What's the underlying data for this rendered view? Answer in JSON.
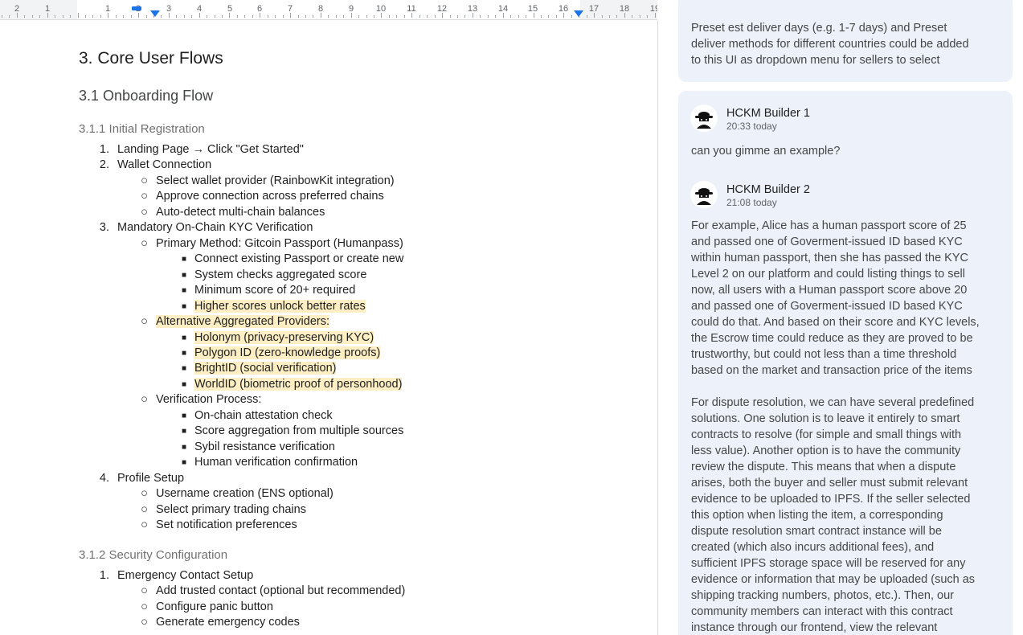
{
  "ruler": {
    "numbers": [
      "2",
      "1",
      "1",
      "2",
      "3",
      "4",
      "5",
      "6",
      "7",
      "8",
      "9",
      "10",
      "11",
      "12",
      "13",
      "14",
      "15",
      "16",
      "17",
      "18",
      "19"
    ]
  },
  "doc": {
    "h1": "3. Core User Flows",
    "h2": "3.1 Onboarding Flow",
    "h3a": "3.1.1 Initial Registration",
    "h3b": "3.1.2 Security Configuration",
    "items": [
      {
        "marker": "1.",
        "text": "Landing Page → Click \"Get Started\""
      },
      {
        "marker": "2.",
        "text": "Wallet Connection"
      },
      {
        "marker": "○",
        "text": "Select wallet provider (RainbowKit integration)"
      },
      {
        "marker": "○",
        "text": "Approve connection across preferred chains"
      },
      {
        "marker": "○",
        "text": "Auto-detect multi-chain balances"
      },
      {
        "marker": "3.",
        "text": "Mandatory On-Chain KYC Verification"
      },
      {
        "marker": "○",
        "text": "Primary Method: Gitcoin Passport (Humanpass)"
      },
      {
        "marker": "■",
        "text": "Connect existing Passport or create new"
      },
      {
        "marker": "■",
        "text": "System checks aggregated score"
      },
      {
        "marker": "■",
        "text": "Minimum score of 20+ required"
      },
      {
        "marker": "■",
        "text": "Higher scores unlock better rates"
      },
      {
        "marker": "○",
        "text": "Alternative Aggregated Providers:"
      },
      {
        "marker": "■",
        "text": "Holonym (privacy-preserving KYC)"
      },
      {
        "marker": "■",
        "text": "Polygon ID (zero-knowledge proofs)"
      },
      {
        "marker": "■",
        "text": "BrightID (social verification)"
      },
      {
        "marker": "■",
        "text": "WorldID (biometric proof of personhood)"
      },
      {
        "marker": "○",
        "text": "Verification Process:"
      },
      {
        "marker": "■",
        "text": "On-chain attestation check"
      },
      {
        "marker": "■",
        "text": "Score aggregation from multiple sources"
      },
      {
        "marker": "■",
        "text": "Sybil resistance verification"
      },
      {
        "marker": "■",
        "text": "Human verification confirmation"
      },
      {
        "marker": "4.",
        "text": "Profile Setup"
      },
      {
        "marker": "○",
        "text": "Username creation (ENS optional)"
      },
      {
        "marker": "○",
        "text": "Select primary trading chains"
      },
      {
        "marker": "○",
        "text": "Set notification preferences"
      }
    ],
    "items2": [
      {
        "marker": "1.",
        "text": "Emergency Contact Setup"
      },
      {
        "marker": "○",
        "text": "Add trusted contact (optional but recommended)"
      },
      {
        "marker": "○",
        "text": "Configure panic button"
      },
      {
        "marker": "○",
        "text": "Generate emergency codes"
      }
    ]
  },
  "comments": {
    "top_card": [
      "Preset est deliver days (e.g. 1-7 days) and Preset",
      "deliver methods for different countries could be added",
      "to this UI as dropdown menu for sellers to select"
    ],
    "c1": {
      "author": "HCKM Builder 1",
      "time": "20:33 today",
      "text": "can you gimme an example?"
    },
    "c2": {
      "author": "HCKM Builder 2",
      "time": "21:08 today",
      "para1": [
        "For example, Alice has a human passport score of 25",
        "and passed one of Goverment-issued ID based KYC",
        "within human passport, then she has passed the KYC",
        "Level 2 on our platform and could listing things to sell",
        "now, all users with a Human passport score above 20",
        "and passed one of Goverment-issued ID based KYC",
        "could do that. And based on their score and KYC levels,",
        "the Escrow time could reduce as they are proved to be",
        "trustworthy, but could not less than a time threshold",
        "based on the market and transaction price of the items"
      ],
      "para2": [
        "For dispute resolution, we can have several predefined",
        "solutions. One solution is to leave it entirely to smart",
        "contracts to resolve (for simple and small things with",
        "less value). Another option is to have the community",
        "review the dispute. This means that when a dispute",
        "arises, both the buyer and seller must submit relevant",
        "evidence to be uploaded to IPFS. If the seller selected",
        "this option when listing the item, a corresponding",
        "dispute resolution smart contract instance will be",
        "created (which also incurs additional fees), and",
        "sufficient IPFS storage space will be reserved for any",
        "evidence or information that may be uploaded (such as",
        "shipping tracking numbers, photos, etc.). Then, our",
        "community members can interact with this contract",
        "instance through our frontend, view the relevant"
      ]
    }
  }
}
